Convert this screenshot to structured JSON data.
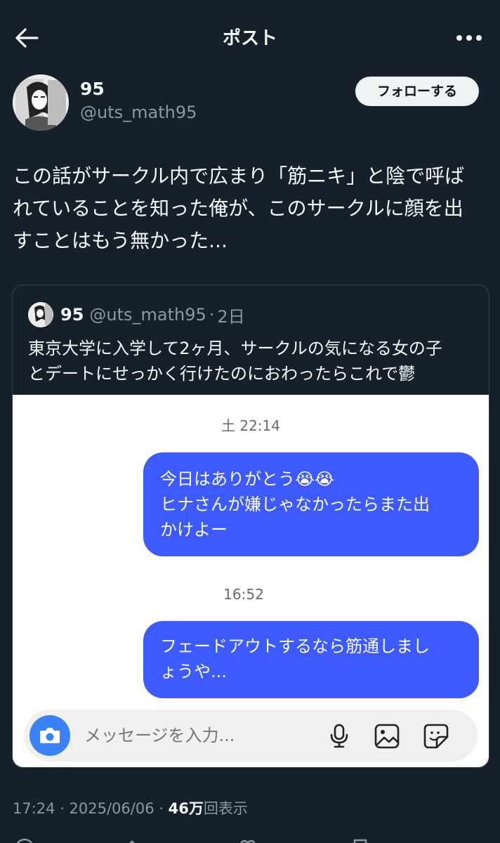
{
  "header": {
    "title": "ポスト"
  },
  "author": {
    "display_name": "95",
    "handle": "@uts_math95",
    "follow_label": "フォローする"
  },
  "post": {
    "lines": [
      "この話がサークル内で広まり「筋ニキ」と陰で呼ば",
      "れていることを知った俺が、このサークルに顔を出",
      "すことはもう無かった..."
    ],
    "timestamp": "17:24 · 2025/06/06 · ",
    "views_count": "46万",
    "views_label": "回表示"
  },
  "quoted": {
    "display_name": "95",
    "handle": "@uts_math95",
    "separator": "·",
    "time": "2日",
    "lines": [
      "東京大学に入学して2ヶ月、サークルの気になる女の子",
      "とデートにせっかく行けたのにおわったらこれで鬱"
    ]
  },
  "chat": {
    "timestamp_1": "土 22:14",
    "message_1": [
      "今日はありがとう😭😭",
      "ヒナさんが嫌じゃなかったらまた出",
      "かけよー"
    ],
    "timestamp_2": "16:52",
    "message_2": [
      "フェードアウトするなら筋通しまし",
      "ょうや..."
    ],
    "input_placeholder": "メッセージを入力..."
  },
  "colors": {
    "background": "#15202b",
    "bubble": "#3d5afe",
    "camera_button": "#3b82f6",
    "muted": "#8b98a5"
  }
}
